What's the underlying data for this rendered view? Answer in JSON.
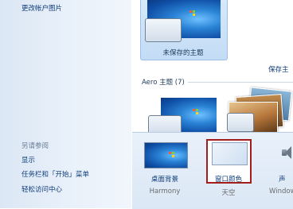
{
  "left_pane": {
    "change_picture_link": "更改帐户图片",
    "see_also_header": "另请参阅",
    "see_also_links": [
      "显示",
      "任务栏和「开始」菜单",
      "轻松访问中心"
    ]
  },
  "themes": {
    "selected_theme_title": "未保存的主题",
    "save_theme_link": "保存主",
    "aero_group_label": "Aero 主题 (7)"
  },
  "bottom_bar": {
    "desktop_background_label": "桌面背景",
    "desktop_background_value": "Harmony",
    "window_color_label": "窗口颜色",
    "window_color_value": "天空",
    "sound_label": "声",
    "sound_value": "Window"
  },
  "colors": {
    "highlight_border": "#a31d1d",
    "link_color": "#0e3d7a",
    "selection_bg": "#c3dcf5"
  }
}
